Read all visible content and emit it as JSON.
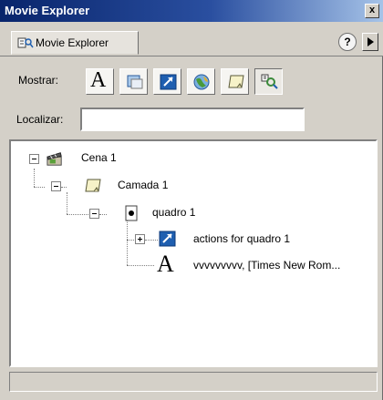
{
  "window": {
    "title": "Movie Explorer",
    "close_glyph": "x"
  },
  "tabs": {
    "active_label": "Movie Explorer",
    "help_glyph": "?"
  },
  "filters": {
    "show_label": "Mostrar:",
    "buttons": [
      {
        "name": "show-text-icon",
        "glyph": "A",
        "pressed": false
      },
      {
        "name": "show-buttons-movieclips-graphics-icon",
        "pressed": false
      },
      {
        "name": "show-actionscripts-icon",
        "pressed": false
      },
      {
        "name": "show-video-sounds-bitmaps-icon",
        "pressed": false
      },
      {
        "name": "show-frames-layers-icon",
        "pressed": false
      },
      {
        "name": "customize-items-icon",
        "pressed": true
      }
    ]
  },
  "find": {
    "label": "Localizar:",
    "value": ""
  },
  "tree": {
    "nodes": [
      {
        "label": "Cena 1",
        "icon": "scene-icon",
        "expanded": true
      },
      {
        "label": "Camada 1",
        "icon": "layer-icon",
        "expanded": true
      },
      {
        "label": "quadro 1",
        "icon": "frame-icon",
        "expanded": true
      },
      {
        "label": "actions for quadro 1",
        "icon": "actions-icon",
        "expanded": false
      },
      {
        "label": "vvvvvvvvv, [Times New Rom...",
        "icon": "text-icon"
      }
    ]
  },
  "colors": {
    "titlebar_start": "#08246b",
    "titlebar_end": "#a6c3e8",
    "panel": "#d4d0c8",
    "action_blue": "#1f5fb0",
    "selection_green": "#3a8a3a"
  }
}
